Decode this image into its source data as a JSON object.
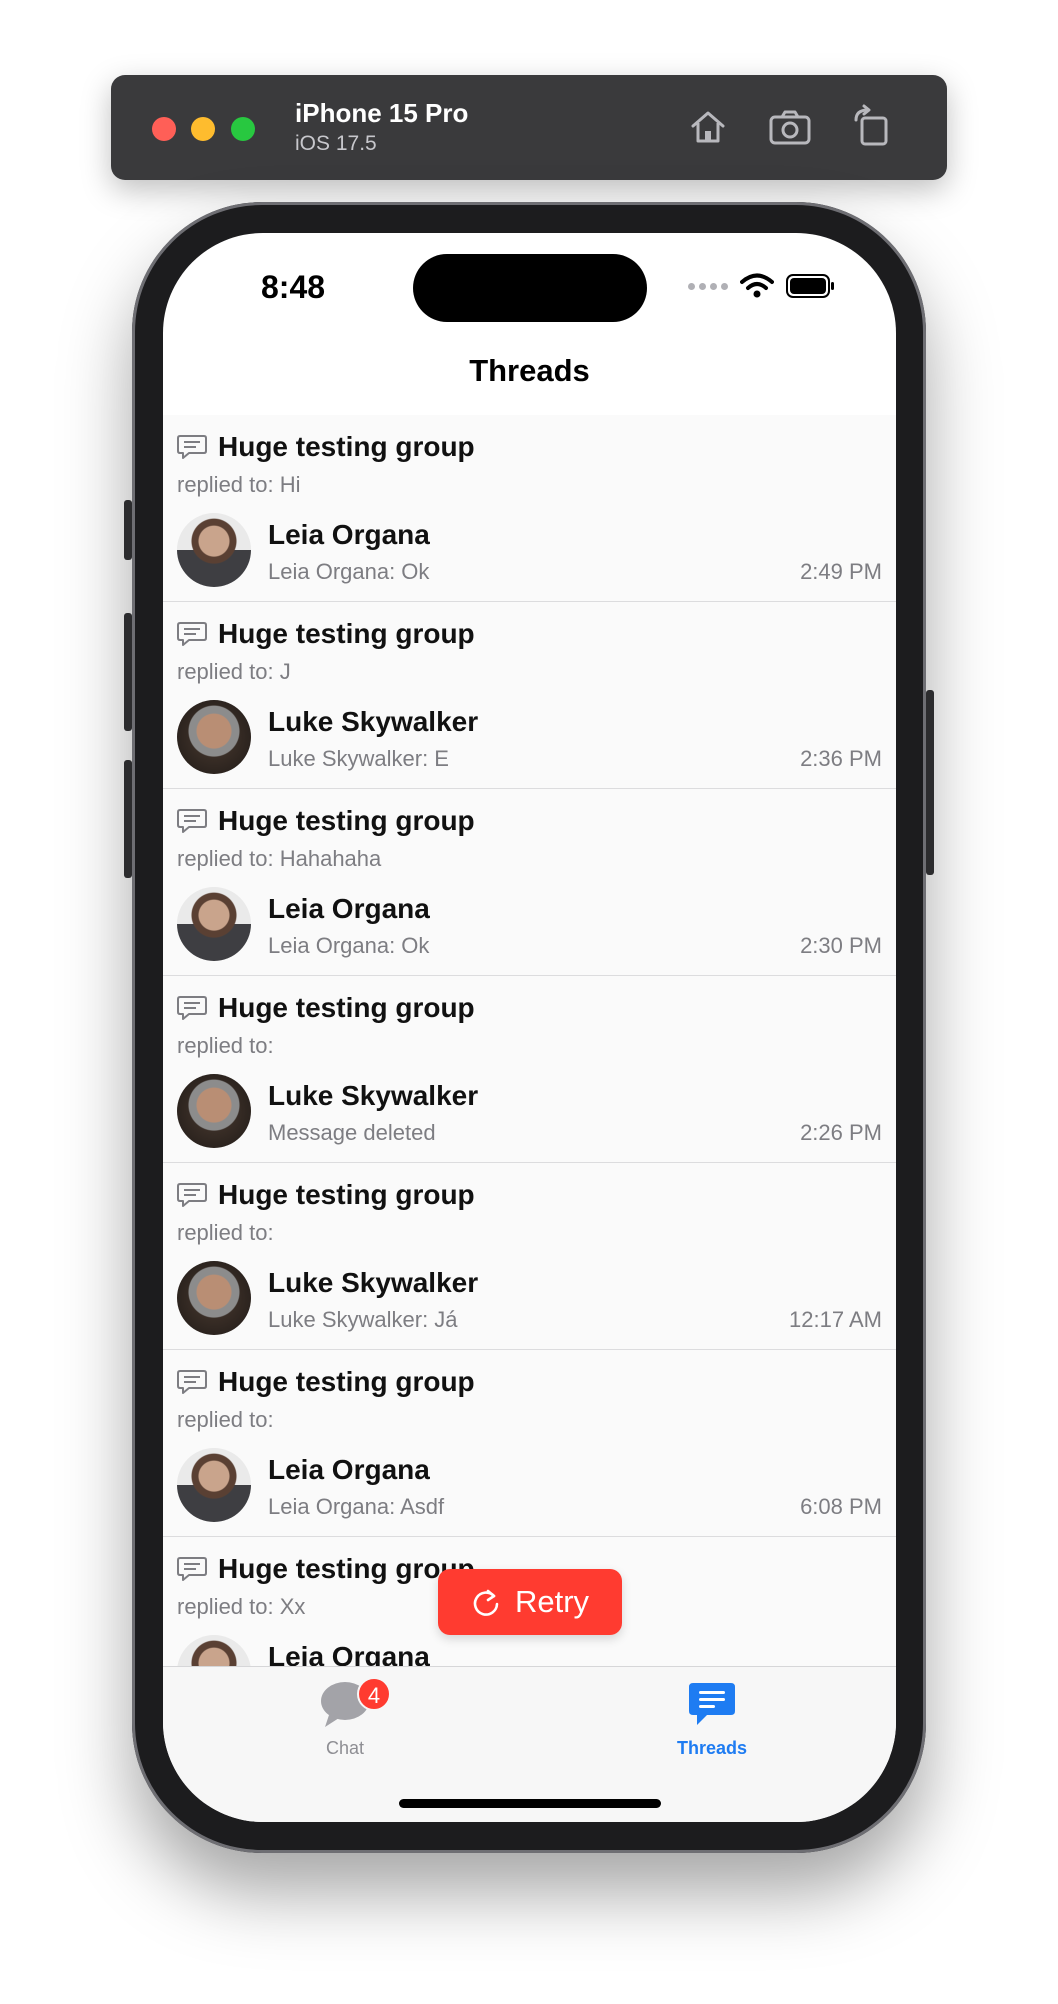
{
  "simulator": {
    "device_name": "iPhone 15 Pro",
    "os_version": "iOS 17.5"
  },
  "status_bar": {
    "time": "8:48"
  },
  "nav": {
    "title": "Threads"
  },
  "threads": [
    {
      "group": "Huge testing group",
      "replied": "replied to: Hi",
      "name": "Leia Organa",
      "message": "Leia Organa: Ok",
      "time": "2:49 PM",
      "avatar": "leia"
    },
    {
      "group": "Huge testing group",
      "replied": "replied to: J",
      "name": "Luke Skywalker",
      "message": "Luke Skywalker: E",
      "time": "2:36 PM",
      "avatar": "luke"
    },
    {
      "group": "Huge testing group",
      "replied": "replied to: Hahahaha",
      "name": "Leia Organa",
      "message": "Leia Organa: Ok",
      "time": "2:30 PM",
      "avatar": "leia"
    },
    {
      "group": "Huge testing group",
      "replied": "replied to:",
      "name": "Luke Skywalker",
      "message": "Message deleted",
      "time": "2:26 PM",
      "avatar": "luke"
    },
    {
      "group": "Huge testing group",
      "replied": "replied to:",
      "name": "Luke Skywalker",
      "message": "Luke Skywalker: Já",
      "time": "12:17 AM",
      "avatar": "luke"
    },
    {
      "group": "Huge testing group",
      "replied": "replied to:",
      "name": "Leia Organa",
      "message": "Leia Organa: Asdf",
      "time": "6:08 PM",
      "avatar": "leia"
    },
    {
      "group": "Huge testing group",
      "replied": "replied to: Xx",
      "name": "Leia Organa",
      "message": "",
      "time": "",
      "avatar": "leia"
    }
  ],
  "retry": {
    "label": "Retry",
    "color": "#ff3b30"
  },
  "tabs": {
    "chat": {
      "label": "Chat",
      "badge": "4"
    },
    "threads": {
      "label": "Threads",
      "color": "#1e7cf2"
    }
  }
}
